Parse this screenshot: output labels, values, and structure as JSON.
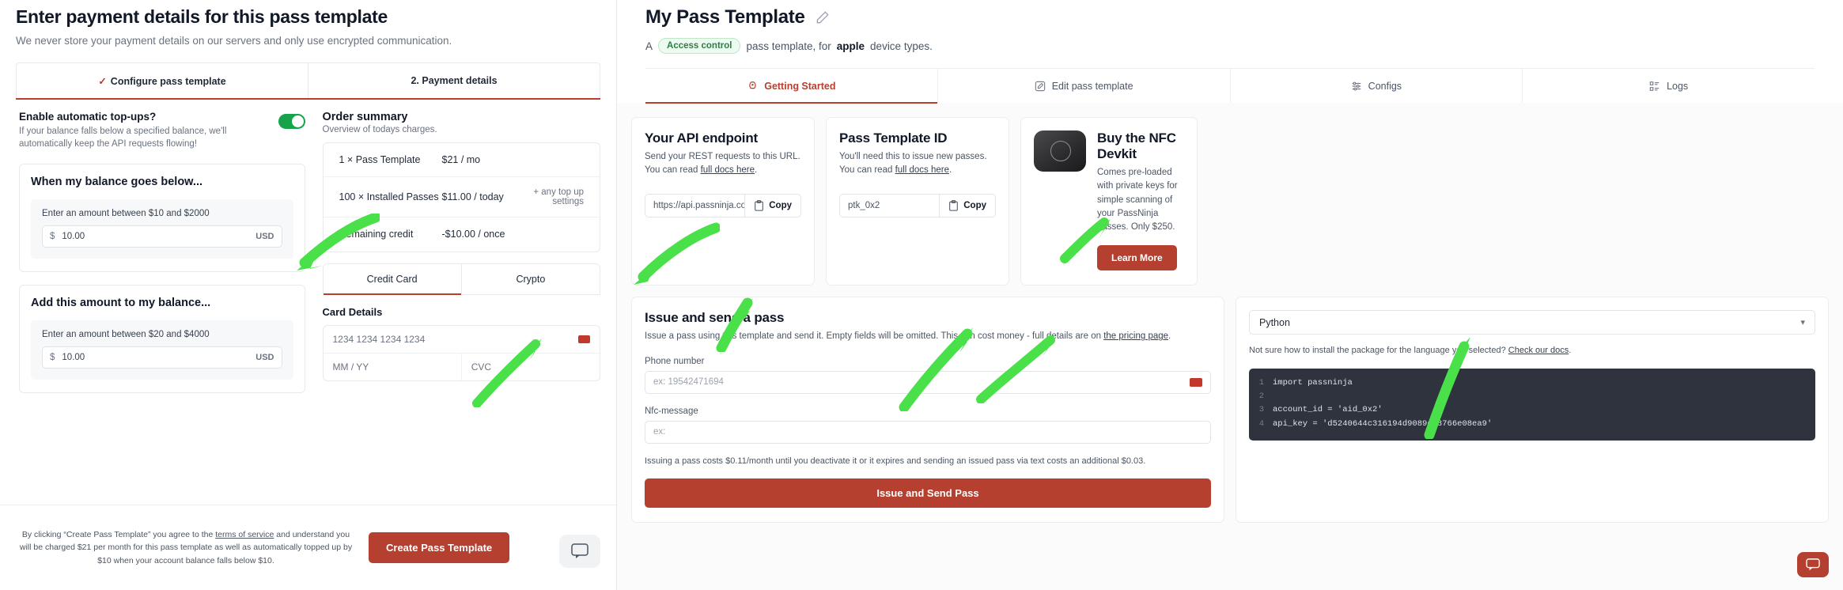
{
  "payment_modal": {
    "title": "Enter payment details for this pass template",
    "subtitle": "We never store your payment details on our servers and only use encrypted communication.",
    "steps": [
      {
        "check": "✓",
        "label": "Configure pass template"
      },
      {
        "check": "",
        "label": "2.  Payment details"
      }
    ],
    "topups": {
      "heading": "Enable automatic top-ups?",
      "description": "If your balance falls below a specified balance, we'll automatically keep the API requests flowing!",
      "enabled": true
    },
    "below_card": {
      "heading": "When my balance goes below...",
      "field_label": "Enter an amount between $10 and $2000",
      "currency_symbol": "$",
      "value": "10.00",
      "currency_code": "USD"
    },
    "add_card": {
      "heading": "Add this amount to my balance...",
      "field_label": "Enter an amount between $20 and $4000",
      "currency_symbol": "$",
      "value": "10.00",
      "currency_code": "USD"
    },
    "order_summary": {
      "title": "Order summary",
      "subtitle": "Overview of todays charges.",
      "rows": [
        {
          "name": "1 × Pass Template",
          "price": "$21 / mo",
          "extra": ""
        },
        {
          "name": "100 × Installed Passes",
          "price": "$11.00 / today",
          "extra": "+ any top up settings"
        },
        {
          "name": "Remaining credit",
          "price": "-$10.00 / once",
          "extra": ""
        }
      ]
    },
    "payment_tabs": [
      {
        "label": "Credit Card",
        "active": true
      },
      {
        "label": "Crypto",
        "active": false
      }
    ],
    "card_details": {
      "title": "Card Details",
      "number_placeholder": "1234 1234 1234 1234",
      "expiry_placeholder": "MM / YY",
      "cvc_placeholder": "CVC"
    },
    "footer": {
      "legal_1": "By clicking “Create Pass Template” you agree to the ",
      "legal_link": "terms of service",
      "legal_2": " and understand you will be charged $21 per month for this pass template as well as automatically topped up by $10 when your account balance falls below $10.",
      "create_button": "Create Pass Template"
    }
  },
  "app": {
    "title": "My Pass Template",
    "meta_prefix": "A",
    "badge": "Access control",
    "meta_mid": "pass template, for",
    "meta_bold": "apple",
    "meta_suffix": "device types.",
    "tabs": [
      {
        "label": "Getting Started",
        "icon": "rocket-icon",
        "active": true
      },
      {
        "label": "Edit pass template",
        "icon": "pencil-square-icon",
        "active": false
      },
      {
        "label": "Configs",
        "icon": "sliders-icon",
        "active": false
      },
      {
        "label": "Logs",
        "icon": "list-icon",
        "active": false
      }
    ],
    "api_endpoint_card": {
      "title": "Your API endpoint",
      "description_1": "Send your REST requests to this URL. You can read ",
      "description_link": "full docs here",
      "description_2": ".",
      "value": "https://api.passninja.com/ap",
      "copy_label": "Copy"
    },
    "template_id_card": {
      "title": "Pass Template ID",
      "description_1": "You'll need this to issue new passes. You can read ",
      "description_link": "full docs here",
      "description_2": ".",
      "value": "ptk_0x2",
      "copy_label": "Copy"
    },
    "nfc_card": {
      "title": "Buy the NFC Devkit",
      "description": "Comes pre-loaded with private keys for simple scanning of your PassNinja passes. Only $250.",
      "button": "Learn More"
    },
    "issue_card": {
      "title": "Issue and send a pass",
      "description_1": "Issue a pass using this template and send it. Empty fields will be omitted. This can cost money - full details are on ",
      "description_link": "the pricing page",
      "description_2": ".",
      "phone_label": "Phone number",
      "phone_placeholder": "ex: 19542471694",
      "nfc_label": "Nfc-message",
      "nfc_placeholder": "ex:",
      "note": "Issuing a pass costs $0.11/month until you deactivate it or it expires and sending an issued pass via text costs an additional $0.03.",
      "button": "Issue and Send Pass"
    },
    "lang_card": {
      "selected": "Python",
      "note_1": "Not sure how to install the package for the language you selected? ",
      "note_link": "Check our docs",
      "note_2": ".",
      "code_lines": [
        {
          "n": "1",
          "text": "import passninja"
        },
        {
          "n": "2",
          "text": ""
        },
        {
          "n": "3",
          "text": "account_id = 'aid_0x2'"
        },
        {
          "n": "4",
          "text": "api_key = 'd5240644c316194d9089e23766e08ea9'"
        }
      ]
    }
  },
  "colors": {
    "accent": "#b5402f",
    "success": "#18a34a",
    "code_bg": "#2f333d"
  }
}
